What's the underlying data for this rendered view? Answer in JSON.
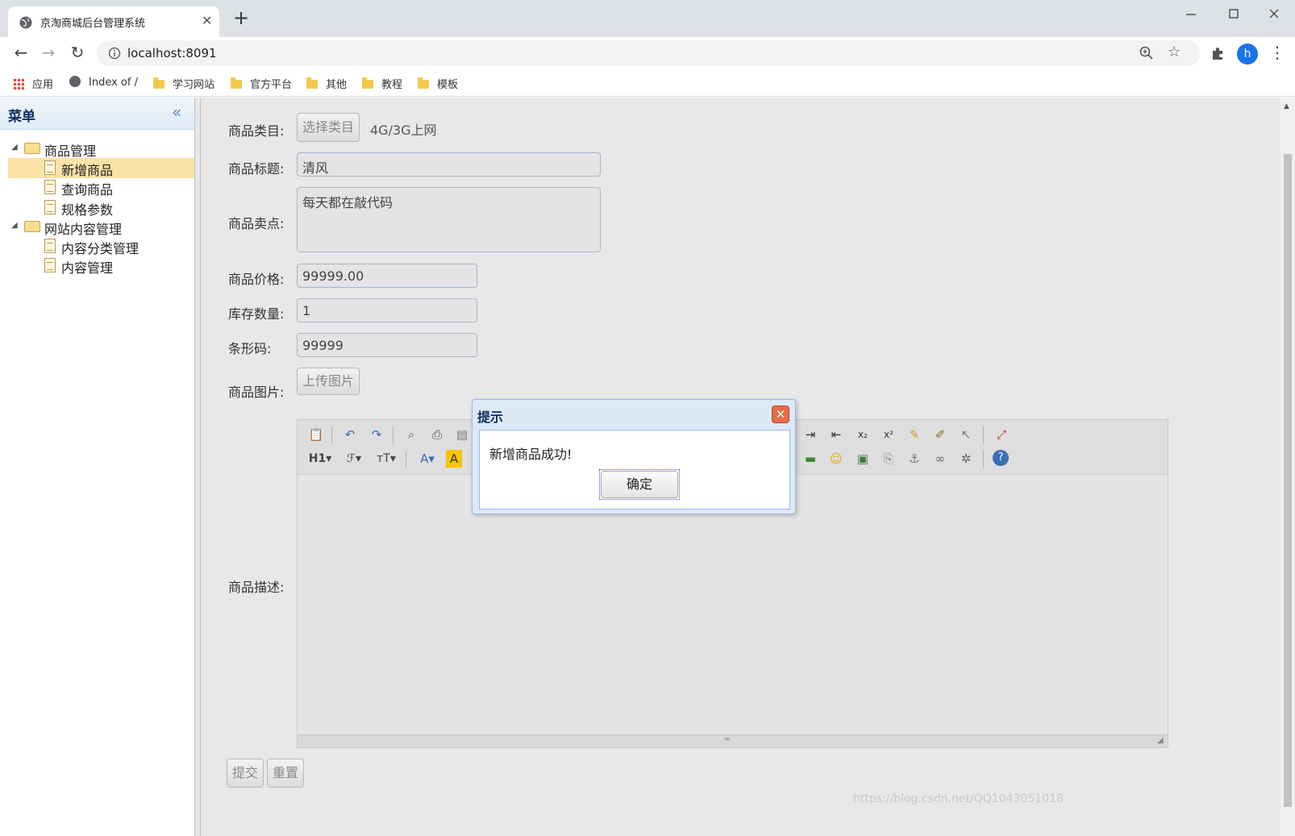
{
  "browser": {
    "tab_title": "京淘商城后台管理系统",
    "url": "localhost:8091",
    "profile_initial": "h",
    "bookmarks": [
      "应用",
      "Index of /",
      "学习网站",
      "官方平台",
      "其他",
      "教程",
      "模板"
    ]
  },
  "sidebar": {
    "title": "菜单",
    "items": [
      {
        "label": "商品管理",
        "type": "folder"
      },
      {
        "label": "新增商品",
        "type": "file",
        "selected": true
      },
      {
        "label": "查询商品",
        "type": "file"
      },
      {
        "label": "规格参数",
        "type": "file"
      },
      {
        "label": "网站内容管理",
        "type": "folder"
      },
      {
        "label": "内容分类管理",
        "type": "file"
      },
      {
        "label": "内容管理",
        "type": "file"
      }
    ]
  },
  "form": {
    "category": {
      "label": "商品类目:",
      "button": "选择类目",
      "value": "4G/3G上网"
    },
    "title": {
      "label": "商品标题:",
      "value": "清风"
    },
    "sell_point": {
      "label": "商品卖点:",
      "value": "每天都在敲代码"
    },
    "price": {
      "label": "商品价格:",
      "value": "99999.00"
    },
    "stock": {
      "label": "库存数量:",
      "value": "1"
    },
    "barcode": {
      "label": "条形码:",
      "value": "99999"
    },
    "image": {
      "label": "商品图片:",
      "button": "上传图片"
    },
    "description": {
      "label": "商品描述:"
    },
    "submit": "提交",
    "reset": "重置"
  },
  "editor_toolbar_icons": [
    "paste-icon",
    "undo-icon",
    "redo-icon",
    "preview-icon",
    "print-icon",
    "template-icon",
    "indent-icon",
    "outdent-icon",
    "subscript-icon",
    "superscript-icon",
    "clear-format-icon",
    "quick-format-icon",
    "select-all-icon",
    "fullscreen-icon",
    "heading-icon",
    "font-family-icon",
    "font-size-icon",
    "font-color-icon",
    "highlight-icon",
    "horizontal-rule-icon",
    "emoticon-icon",
    "image-icon",
    "page-break-icon",
    "anchor-icon",
    "link-icon",
    "unlink-icon",
    "help-icon"
  ],
  "dialog": {
    "title": "提示",
    "message": "新增商品成功!",
    "ok": "确定"
  },
  "watermark": "https://blog.csdn.net/QQ1043051018",
  "colors": {
    "dialog_header": "#dde9f6",
    "selected_menu": "#fbe3a7",
    "profile": "#1a73e8"
  }
}
